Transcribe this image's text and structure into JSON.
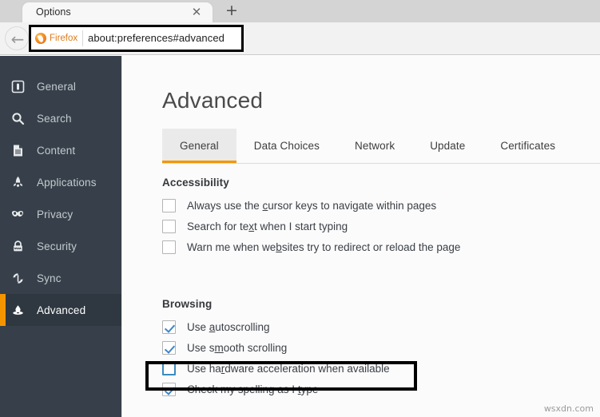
{
  "browser": {
    "tab_title": "Options",
    "close_icon": "close-icon",
    "newtab_icon": "plus-icon",
    "back_icon": "back-arrow-icon",
    "identity_label": "Firefox",
    "url": "about:preferences#advanced",
    "highlight_color": "#000000"
  },
  "sidebar": {
    "items": [
      {
        "label": "General",
        "icon": "sliders-icon",
        "active": false
      },
      {
        "label": "Search",
        "icon": "magnifier-icon",
        "active": false
      },
      {
        "label": "Content",
        "icon": "document-icon",
        "active": false
      },
      {
        "label": "Applications",
        "icon": "rocket-icon",
        "active": false
      },
      {
        "label": "Privacy",
        "icon": "mask-icon",
        "active": false
      },
      {
        "label": "Security",
        "icon": "padlock-icon",
        "active": false
      },
      {
        "label": "Sync",
        "icon": "sync-icon",
        "active": false
      },
      {
        "label": "Advanced",
        "icon": "potion-flask-icon",
        "active": true
      }
    ],
    "accent_color": "#f49500",
    "background_color": "#37404a",
    "active_background_color": "#2f3841"
  },
  "main": {
    "title": "Advanced",
    "tabs": [
      {
        "label": "General",
        "active": true
      },
      {
        "label": "Data Choices",
        "active": false
      },
      {
        "label": "Network",
        "active": false
      },
      {
        "label": "Update",
        "active": false
      },
      {
        "label": "Certificates",
        "active": false
      }
    ],
    "sections": [
      {
        "title": "Accessibility",
        "options": [
          {
            "pre": "Always use the ",
            "accel": "c",
            "post": "ursor keys to navigate within pages",
            "checked": false,
            "focused": false
          },
          {
            "pre": "Search for te",
            "accel": "x",
            "post": "t when I start typing",
            "checked": false,
            "focused": false
          },
          {
            "pre": "Warn me when we",
            "accel": "b",
            "post": "sites try to redirect or reload the page",
            "checked": false,
            "focused": false
          }
        ]
      },
      {
        "title": "Browsing",
        "options": [
          {
            "pre": "Use ",
            "accel": "a",
            "post": "utoscrolling",
            "checked": true,
            "focused": false
          },
          {
            "pre": "Use s",
            "accel": "m",
            "post": "ooth scrolling",
            "checked": true,
            "focused": false
          },
          {
            "pre": "Use ha",
            "accel": "r",
            "post": "dware acceleration when available",
            "checked": false,
            "focused": true
          },
          {
            "pre": "Check my spelling as I ",
            "accel": "t",
            "post": "ype",
            "checked": true,
            "focused": false
          }
        ]
      }
    ]
  },
  "watermark": "wsxdn.com"
}
